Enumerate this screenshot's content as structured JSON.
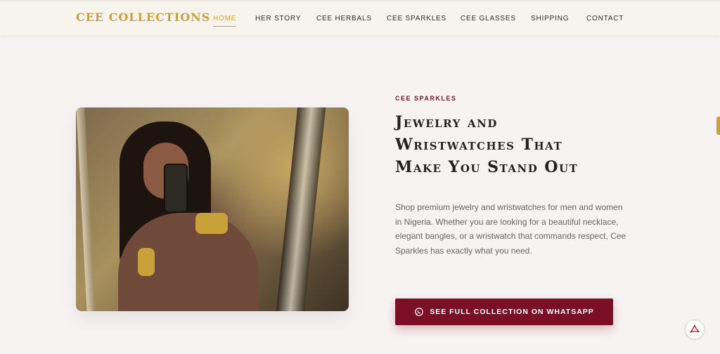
{
  "brand": {
    "logo": "CEE COLLECTIONS",
    "accent": "#c9a13b",
    "primary": "#7a0f25"
  },
  "nav": {
    "items": [
      {
        "label": "HOME",
        "active": true
      },
      {
        "label": "HER STORY",
        "active": false
      },
      {
        "label": "CEE HERBALS",
        "active": false
      },
      {
        "label": "CEE SPARKLES",
        "active": false
      },
      {
        "label": "CEE GLASSES",
        "active": false
      },
      {
        "label": "SHIPPING",
        "active": false
      },
      {
        "label": "CONTACT",
        "active": false
      }
    ]
  },
  "hero": {
    "eyebrow": "CEE SPARKLES",
    "heading_lines": [
      "Jewelry and",
      "Wristwatches That",
      "Make You Stand Out"
    ],
    "description": "Shop premium jewelry and wristwatches for men and women in Nigeria. Whether you are looking for a beautiful necklace, elegant bangles, or a wristwatch that commands respect, Cee Sparkles has exactly what you need.",
    "cta_label": "SEE FULL COLLECTION ON WHATSAPP",
    "cta_icon": "whatsapp-icon"
  },
  "floating": {
    "pdf_icon": "pdf-icon"
  }
}
